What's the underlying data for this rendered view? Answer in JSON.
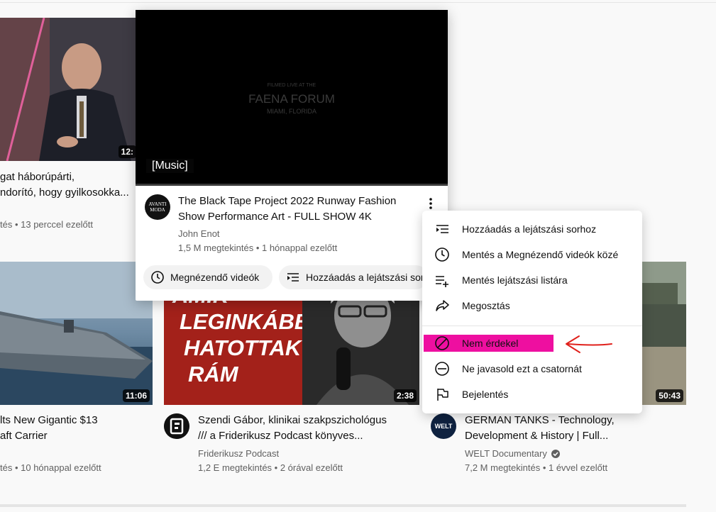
{
  "videos": {
    "top_left": {
      "title_line1": "gat háborúpárti,",
      "title_line2": "ndorító, hogy gyilkosokka...",
      "meta": "tés • 13 perccel ezelőtt",
      "duration": "12:"
    },
    "bottom_left": {
      "title_line1": "lts New Gigantic $13",
      "title_line2": "aft Carrier",
      "meta": "tés • 10 hónappal ezelőtt",
      "duration": "11:06"
    },
    "bottom_middle": {
      "title_line1": "Szendi Gábor, klinikai szakpszichológus",
      "title_line2": "/// a Friderikusz Podcast könyves...",
      "channel": "Friderikusz Podcast",
      "meta": "1,2 E megtekintés • 2 órával ezelőtt",
      "duration": "2:38",
      "thumb_text": [
        "AMIK",
        "LEGINKÁBB",
        "HATOTTAK",
        "RÁM"
      ]
    },
    "bottom_right": {
      "title_line1": "GERMAN TANKS - Technology,",
      "title_line2": "Development & History | Full...",
      "channel": "WELT Documentary",
      "meta": "7,2 M megtekintés • 1 évvel ezelőtt",
      "duration": "50:43",
      "avatar_text": "WELT"
    }
  },
  "hover_card": {
    "player_caption": "[Music]",
    "overlay_small": "FILMED LIVE AT THE",
    "overlay_big": "FAENA FORUM",
    "overlay_sub": "MIAMI, FLORIDA",
    "avatar_text_1": "AVANTI",
    "avatar_text_2": "MODA",
    "title_line1": "The Black Tape Project 2022 Runway Fashion",
    "title_line2": "Show Performance Art - FULL SHOW 4K",
    "channel": "John Enot",
    "meta": "1,5 M megtekintés • 1 hónappal ezelőtt",
    "chip_watch_later": "Megnézendő videók",
    "chip_add_queue": "Hozzáadás a lejátszási sorhoz"
  },
  "menu": {
    "items": [
      {
        "label": "Hozzáadás a lejátszási sorhoz",
        "icon": "queue-icon"
      },
      {
        "label": "Mentés a Megnézendő videók közé",
        "icon": "clock-icon"
      },
      {
        "label": "Mentés lejátszási listára",
        "icon": "playlist-add-icon"
      },
      {
        "label": "Megosztás",
        "icon": "share-icon"
      },
      {
        "label": "Nem érdekel",
        "icon": "not-interested-icon"
      },
      {
        "label": "Ne javasold ezt a csatornát",
        "icon": "block-channel-icon"
      },
      {
        "label": "Bejelentés",
        "icon": "flag-icon"
      }
    ],
    "highlight_color": "#ee0fa0",
    "annotation_arrow_color": "#e0201b"
  }
}
